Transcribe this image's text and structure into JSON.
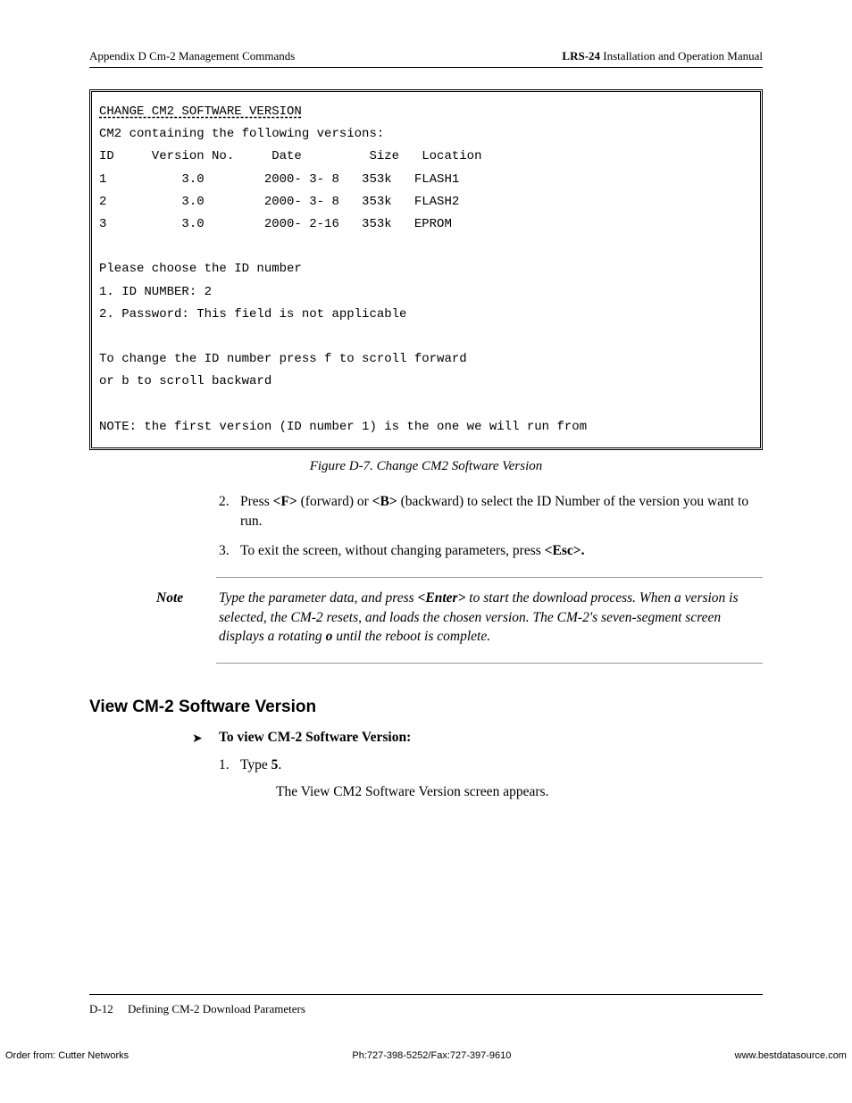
{
  "header": {
    "left": "Appendix D  Cm-2 Management Commands",
    "right_bold": "LRS-24",
    "right_rest": " Installation and Operation Manual"
  },
  "codebox": {
    "title": "CHANGE CM2 SOFTWARE VERSION",
    "subtitle": "CM2 containing the following versions:",
    "columns": "ID     Version No.     Date         Size   Location",
    "rows": [
      "1          3.0        2000- 3- 8   353k   FLASH1",
      "2          3.0        2000- 3- 8   353k   FLASH2",
      "3          3.0        2000- 2-16   353k   EPROM"
    ],
    "prompt1": "Please choose the ID number",
    "prompt2": "1. ID NUMBER: 2",
    "prompt3": "2. Password: This field is not applicable",
    "instr1": "To change the ID number press f to scroll forward",
    "instr2": "or b to scroll backward",
    "note": "NOTE: the first version (ID number 1) is the one we will run from"
  },
  "figure_caption": "Figure D-7.  Change CM2 Software Version",
  "list": {
    "item2_pre": " Press ",
    "item2_key1": "<F>",
    "item2_mid1": " (forward) or ",
    "item2_key2": "<B>",
    "item2_mid2": " (backward) to select the ID Number of the version you want to run.",
    "item3_pre": "To exit the screen, without changing parameters, press ",
    "item3_key": "<Esc>."
  },
  "note": {
    "label": "Note",
    "text_pre": "Type the parameter data, and press ",
    "text_key": "<Enter>",
    "text_mid": " to start the download process. When a version is selected, the CM-2 resets, and loads the chosen version. The CM-2's seven-segment screen displays a rotating ",
    "text_bold_o": "o",
    "text_end": " until the reboot is complete."
  },
  "section_heading": "View CM-2 Software Version",
  "sub_action": "To view CM-2 Software Version:",
  "step1_num": "1.",
  "step1_pre": "Type ",
  "step1_bold": "5",
  "step1_end": ".",
  "step1_result": "The View CM2 Software Version screen appears.",
  "footer": {
    "page_num": "D-12",
    "title": "Defining CM-2 Download Parameters"
  },
  "order": {
    "left": "Order from: Cutter Networks",
    "center": "Ph:727-398-5252/Fax:727-397-9610",
    "right": "www.bestdatasource.com"
  }
}
